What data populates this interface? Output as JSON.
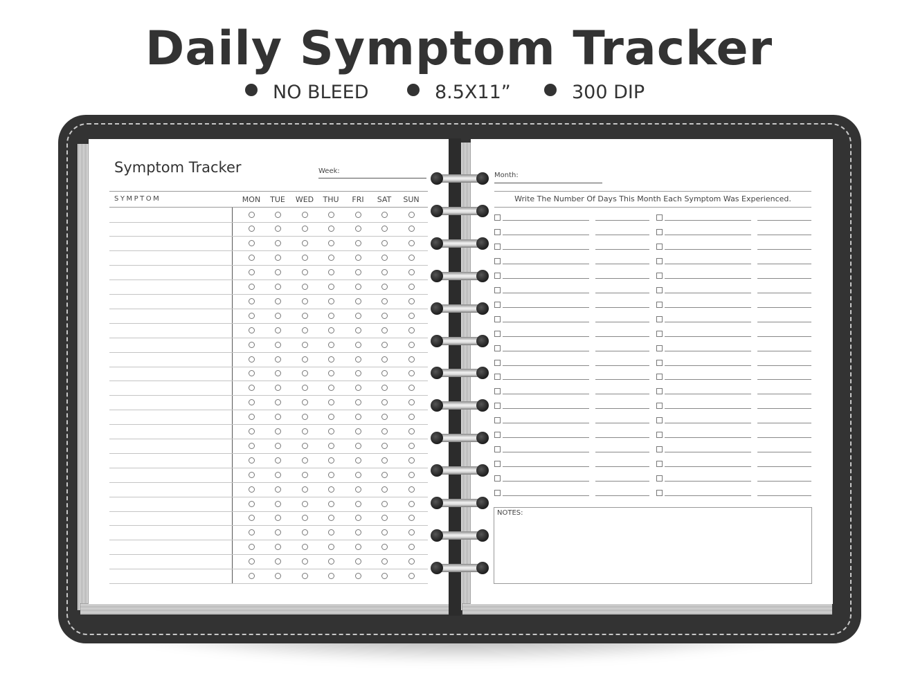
{
  "header": {
    "title": "Daily Symptom Tracker",
    "specs": [
      "NO BLEED",
      "8.5X11”",
      "300 DIP"
    ],
    "spec_bullet_icon": "bullet-dot-icon"
  },
  "left_page": {
    "title": "Symptom Tracker",
    "week_label": "Week:",
    "week_value": "",
    "symptom_header": "SYMPTOM",
    "days": [
      "MON",
      "TUE",
      "WED",
      "THU",
      "FRI",
      "SAT",
      "SUN"
    ],
    "row_count": 26,
    "row_icon": "empty-circle-icon"
  },
  "right_page": {
    "month_label": "Month:",
    "month_value": "",
    "instruction": "Write The Number Of Days This Month Each Symptom Was Experienced.",
    "row_count": 20,
    "columns": 2,
    "row_icon": "empty-checkbox-icon",
    "notes_label": "NOTES:",
    "notes_value": ""
  },
  "binding": {
    "ring_count": 13,
    "ring_icon": "spiral-ring-icon"
  },
  "colors": {
    "cover": "#333333",
    "stitching": "#c8c8c8",
    "page": "#ffffff",
    "text": "#333333"
  }
}
